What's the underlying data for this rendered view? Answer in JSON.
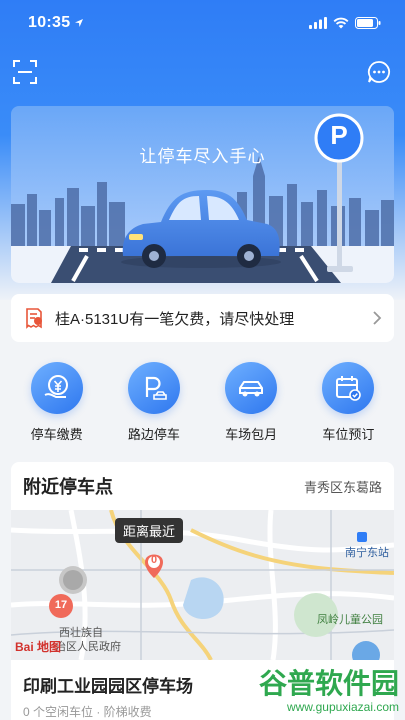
{
  "status": {
    "time": "10:35"
  },
  "banner": {
    "slogan": "让停车尽入手心",
    "sign_letter": "P"
  },
  "alert": {
    "text": "桂A·5131U有一笔欠费，请尽快处理"
  },
  "services": [
    {
      "label": "停车缴费",
      "icon": "parking-payment-icon"
    },
    {
      "label": "路边停车",
      "icon": "roadside-parking-icon"
    },
    {
      "label": "车场包月",
      "icon": "monthly-car-icon"
    },
    {
      "label": "车位预订",
      "icon": "calendar-booking-icon"
    }
  ],
  "nearby": {
    "title": "附近停车点",
    "location": "青秀区东葛路",
    "map": {
      "tooltip": "距离最近",
      "marker_primary": "0",
      "marker_secondary": "17",
      "station_label": "南宁东站",
      "park_label": "凤岭儿童公园",
      "place_label_1": "西壮族自",
      "place_label_2": "治区人民政府",
      "logo_text": "Bai 地图"
    },
    "lot": {
      "name": "印刷工业园园区停车场",
      "meta": "0 个空闲车位 · 阶梯收费"
    }
  },
  "watermark": {
    "title": "谷普软件园",
    "url": "www.gupuxiazai.com"
  },
  "colors": {
    "primary": "#2f7df6",
    "alert_icon": "#e8563a",
    "marker": "#f06a5a"
  }
}
